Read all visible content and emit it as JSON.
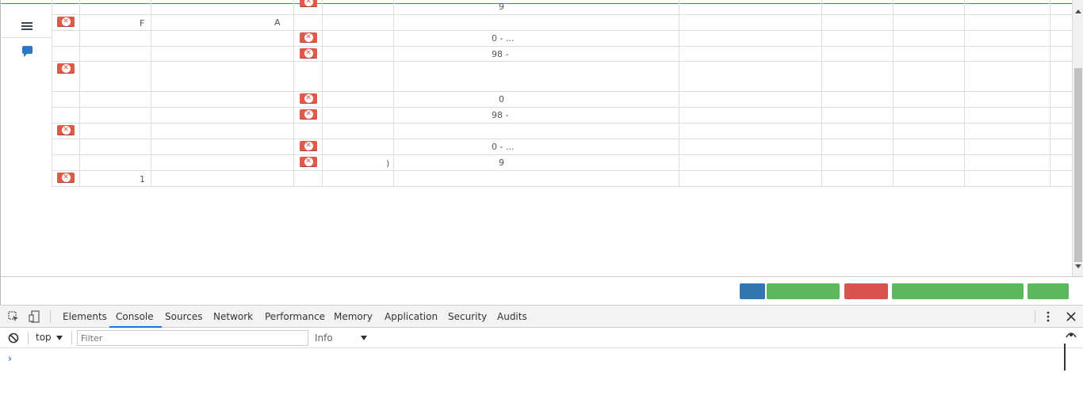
{
  "table": {
    "rows": [
      {
        "c2": "",
        "c4": "",
        "c6": "9"
      },
      {
        "c2": "F",
        "c3": "A",
        "c6": ""
      },
      {
        "c6": "0 - ..."
      },
      {
        "c6": "98 -"
      },
      {
        "c2": "",
        "c3": ""
      },
      {
        "c6": "0"
      },
      {
        "c6": "98 -"
      },
      {
        "c2": ""
      },
      {
        "c6": "0 - ..."
      },
      {
        "c5": ")",
        "c6": "9"
      },
      {
        "c2": "1"
      }
    ]
  },
  "icons": {
    "list": "list-icon",
    "chat": "chat-icon",
    "delete": "delete-icon"
  },
  "footer_colors": {
    "blue": "#3276b1",
    "green": "#5cb85c",
    "red": "#d9534f"
  },
  "devtools": {
    "tabs": [
      "Elements",
      "Console",
      "Sources",
      "Network",
      "Performance",
      "Memory",
      "Application",
      "Security",
      "Audits"
    ],
    "active_tab": "Console",
    "context": "top",
    "filter_placeholder": "Filter",
    "level": "Info",
    "prompt": "›"
  }
}
